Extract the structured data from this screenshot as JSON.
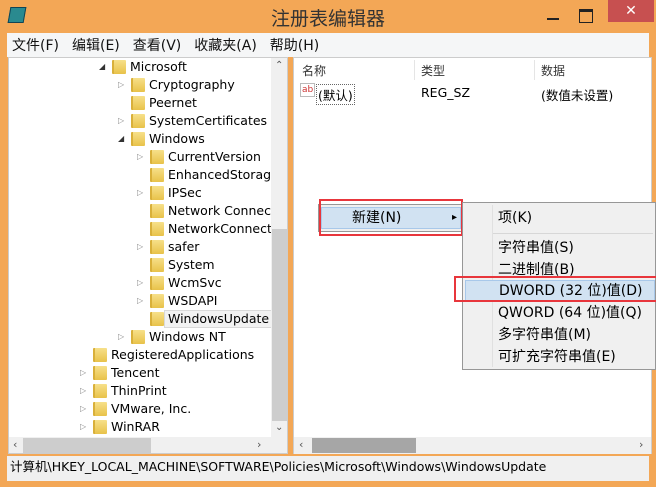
{
  "window": {
    "title": "注册表编辑器",
    "close_glyph": "✕"
  },
  "menubar": [
    "文件(F)",
    "编辑(E)",
    "查看(V)",
    "收藏夹(A)",
    "帮助(H)"
  ],
  "tree": [
    {
      "label": "Microsoft",
      "level": 2,
      "expander": "open"
    },
    {
      "label": "Cryptography",
      "level": 3,
      "expander": "closed"
    },
    {
      "label": "Peernet",
      "level": 3,
      "expander": "none"
    },
    {
      "label": "SystemCertificates",
      "level": 3,
      "expander": "closed"
    },
    {
      "label": "Windows",
      "level": 3,
      "expander": "open"
    },
    {
      "label": "CurrentVersion",
      "level": 4,
      "expander": "closed"
    },
    {
      "label": "EnhancedStorage",
      "level": 4,
      "expander": "none"
    },
    {
      "label": "IPSec",
      "level": 4,
      "expander": "closed"
    },
    {
      "label": "Network Connecti",
      "level": 4,
      "expander": "none"
    },
    {
      "label": "NetworkConnectiv",
      "level": 4,
      "expander": "none"
    },
    {
      "label": "safer",
      "level": 4,
      "expander": "closed"
    },
    {
      "label": "System",
      "level": 4,
      "expander": "none"
    },
    {
      "label": "WcmSvc",
      "level": 4,
      "expander": "closed"
    },
    {
      "label": "WSDAPI",
      "level": 4,
      "expander": "closed"
    },
    {
      "label": "WindowsUpdate",
      "level": 4,
      "expander": "none",
      "selected": true
    },
    {
      "label": "Windows NT",
      "level": 3,
      "expander": "closed"
    },
    {
      "label": "RegisteredApplications",
      "level": 1,
      "expander": "none"
    },
    {
      "label": "Tencent",
      "level": 1,
      "expander": "closed"
    },
    {
      "label": "ThinPrint",
      "level": 1,
      "expander": "closed"
    },
    {
      "label": "VMware, Inc.",
      "level": 1,
      "expander": "closed"
    },
    {
      "label": "WinRAR",
      "level": 1,
      "expander": "closed"
    }
  ],
  "list": {
    "columns": [
      "名称",
      "类型",
      "数据"
    ],
    "rows": [
      {
        "name": "(默认)",
        "type": "REG_SZ",
        "data": "(数值未设置)",
        "icon": "ab"
      }
    ]
  },
  "context_menu": {
    "item": "新建(N)",
    "arrow": "▸"
  },
  "submenu": [
    "项(K)",
    "字符串值(S)",
    "二进制值(B)",
    "DWORD (32 位)值(D)",
    "QWORD (64 位)值(Q)",
    "多字符串值(M)",
    "可扩充字符串值(E)"
  ],
  "submenu_highlight": "DWORD (32 位)值(D)",
  "status": "计算机\\HKEY_LOCAL_MACHINE\\SOFTWARE\\Policies\\Microsoft\\Windows\\WindowsUpdate",
  "colors": {
    "frame": "#f3a756",
    "close": "#c75050",
    "highlight": "#d1e2f2",
    "annotation": "#e8363c"
  }
}
